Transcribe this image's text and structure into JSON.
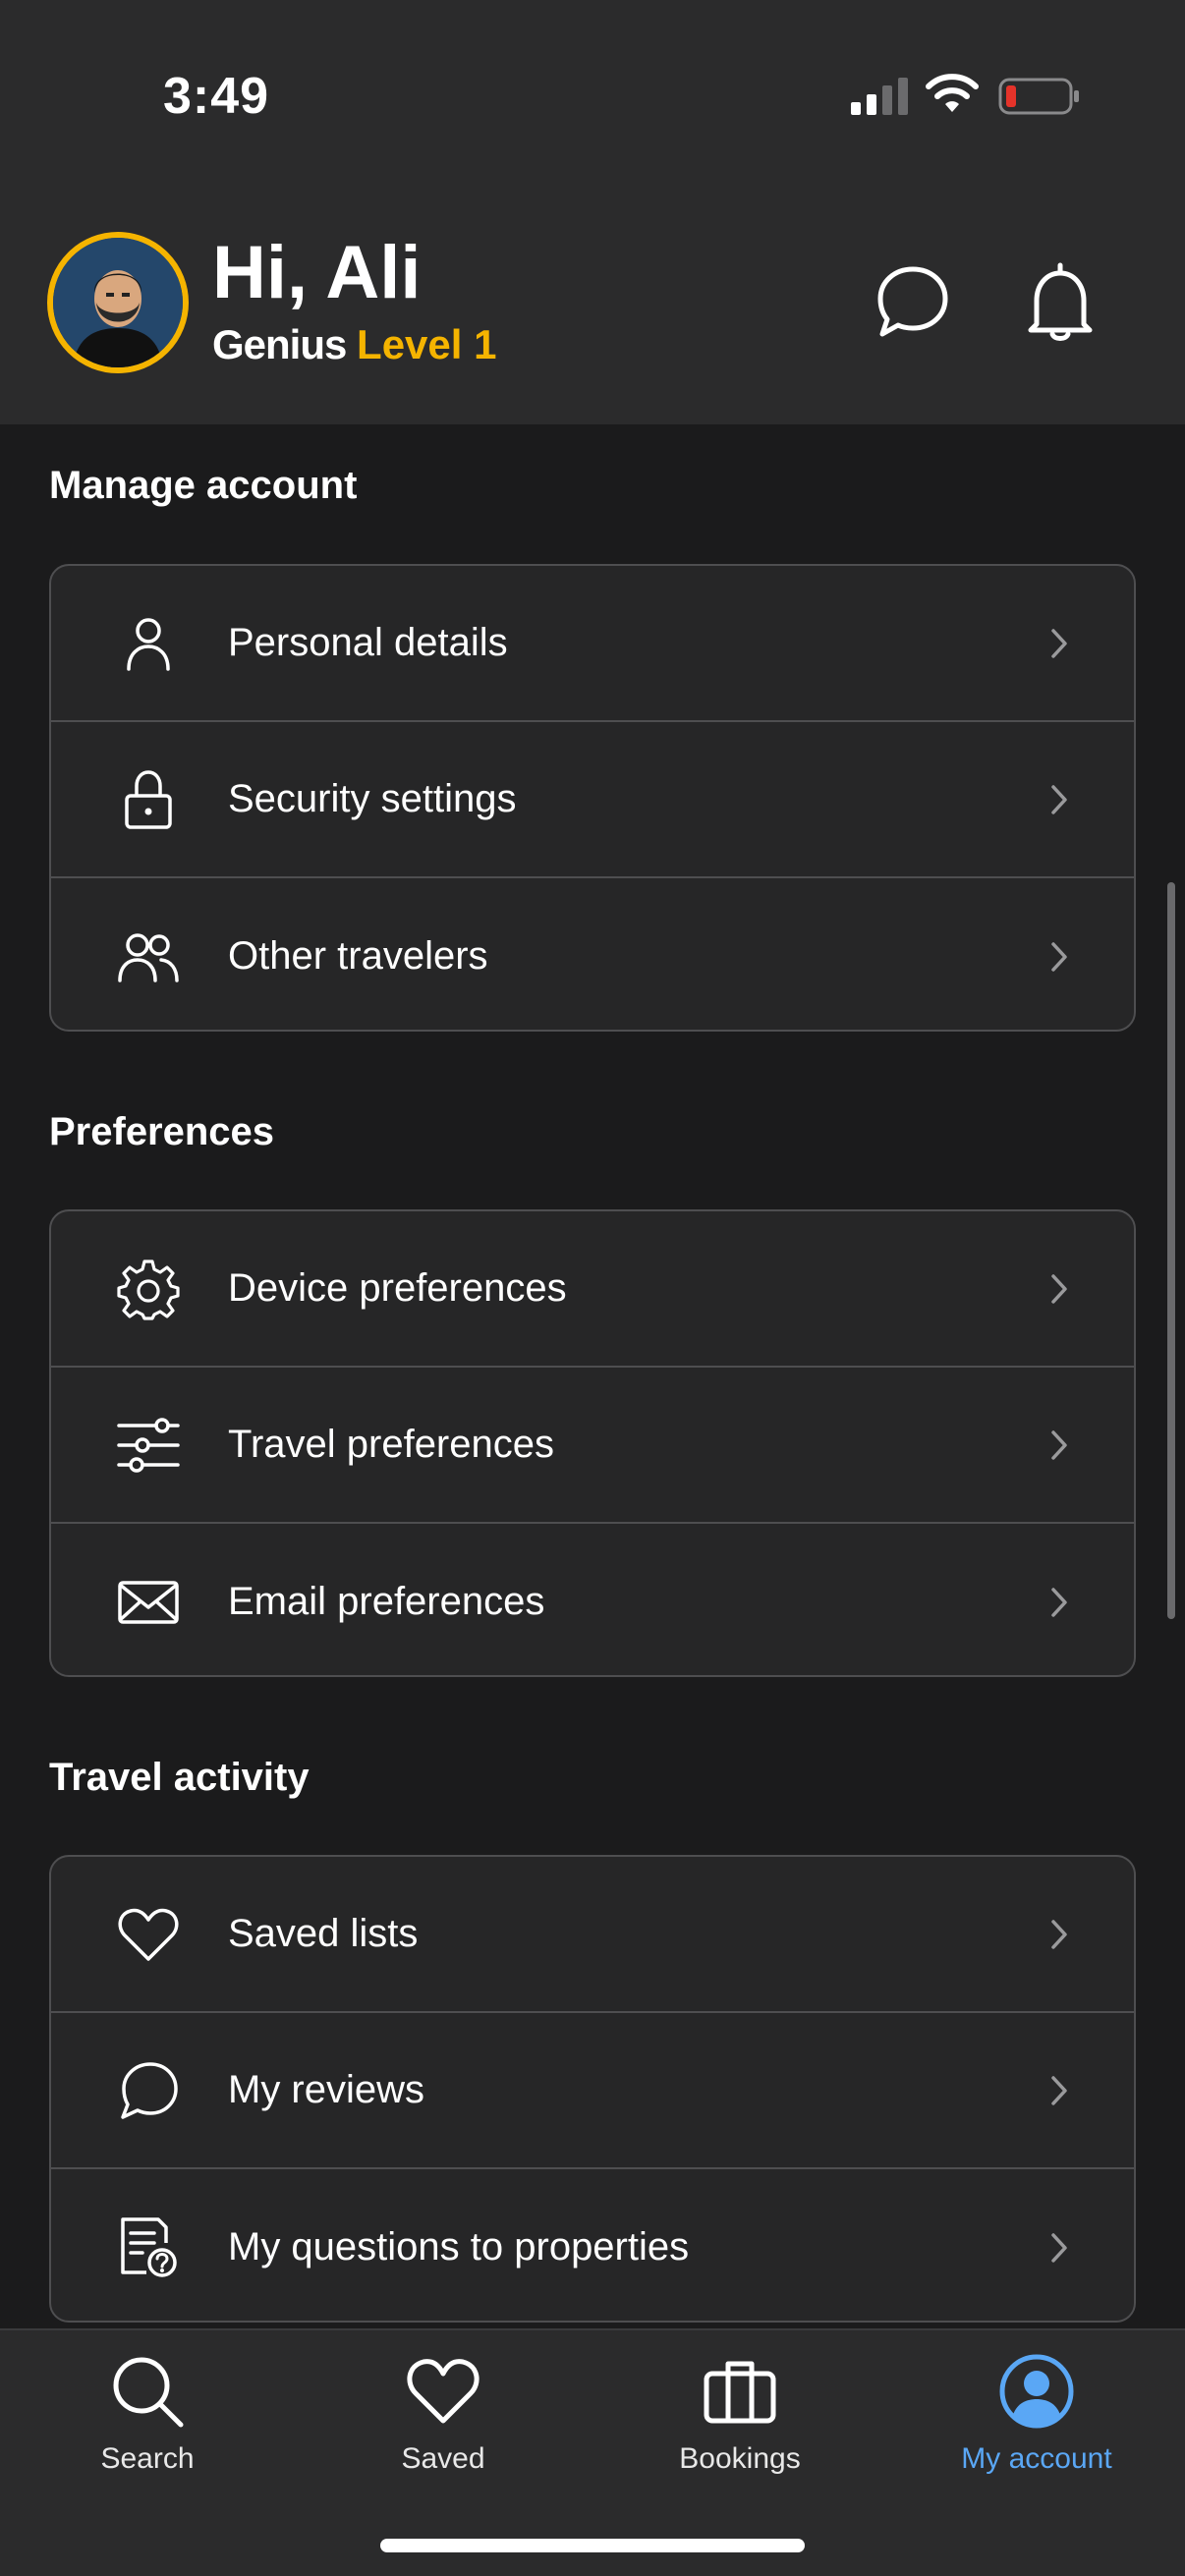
{
  "status_bar": {
    "time": "3:49"
  },
  "header": {
    "greeting": "Hi, Ali",
    "genius_label": "Genius",
    "level_label": "Level 1",
    "colors": {
      "accent": "#f5b400",
      "background": "#2b2b2c"
    }
  },
  "sections": [
    {
      "title": "Manage account",
      "items": [
        {
          "label": "Personal details",
          "icon": "person-icon"
        },
        {
          "label": "Security settings",
          "icon": "lock-icon"
        },
        {
          "label": "Other travelers",
          "icon": "people-icon"
        }
      ]
    },
    {
      "title": "Preferences",
      "items": [
        {
          "label": "Device preferences",
          "icon": "gear-icon"
        },
        {
          "label": "Travel preferences",
          "icon": "sliders-icon"
        },
        {
          "label": "Email preferences",
          "icon": "envelope-icon"
        }
      ]
    },
    {
      "title": "Travel activity",
      "items": [
        {
          "label": "Saved lists",
          "icon": "heart-icon"
        },
        {
          "label": "My reviews",
          "icon": "chat-bubble-icon"
        },
        {
          "label": "My questions to properties",
          "icon": "question-document-icon"
        }
      ]
    }
  ],
  "tabbar": {
    "tabs": [
      {
        "label": "Search",
        "icon": "search-icon"
      },
      {
        "label": "Saved",
        "icon": "heart-icon"
      },
      {
        "label": "Bookings",
        "icon": "briefcase-icon"
      },
      {
        "label": "My account",
        "icon": "account-icon",
        "active": true
      }
    ],
    "active_color": "#5aa7f5"
  }
}
